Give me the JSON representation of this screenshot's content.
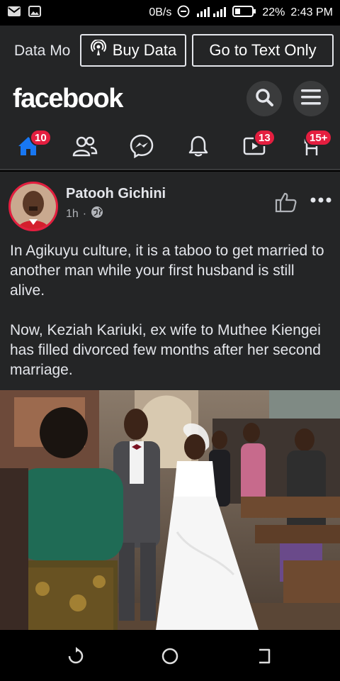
{
  "status_bar": {
    "speed": "0B/s",
    "battery": "22%",
    "time": "2:43 PM"
  },
  "data_bar": {
    "mode_label": "Data Mo",
    "buy_data_label": "Buy Data",
    "text_only_label": "Go to Text Only"
  },
  "header": {
    "logo": "facebook",
    "tabs": [
      {
        "name": "home",
        "badge": "10"
      },
      {
        "name": "friends",
        "badge": ""
      },
      {
        "name": "messenger",
        "badge": ""
      },
      {
        "name": "notifications",
        "badge": ""
      },
      {
        "name": "watch",
        "badge": "13"
      },
      {
        "name": "marketplace",
        "badge": "15+"
      }
    ]
  },
  "post": {
    "author": "Patooh Gichini",
    "time": "1h",
    "separator": "·",
    "paragraphs": [
      "In Agikuyu culture, it is a taboo to get married to another man while your first husband is still alive.",
      "Now, Keziah Kariuki, ex wife to Muthee Kiengei has filled divorced few months after her second marriage."
    ]
  },
  "colors": {
    "background": "#242526",
    "accent": "#1877f2",
    "badge": "#e41e3f",
    "text": "#e4e6eb"
  }
}
